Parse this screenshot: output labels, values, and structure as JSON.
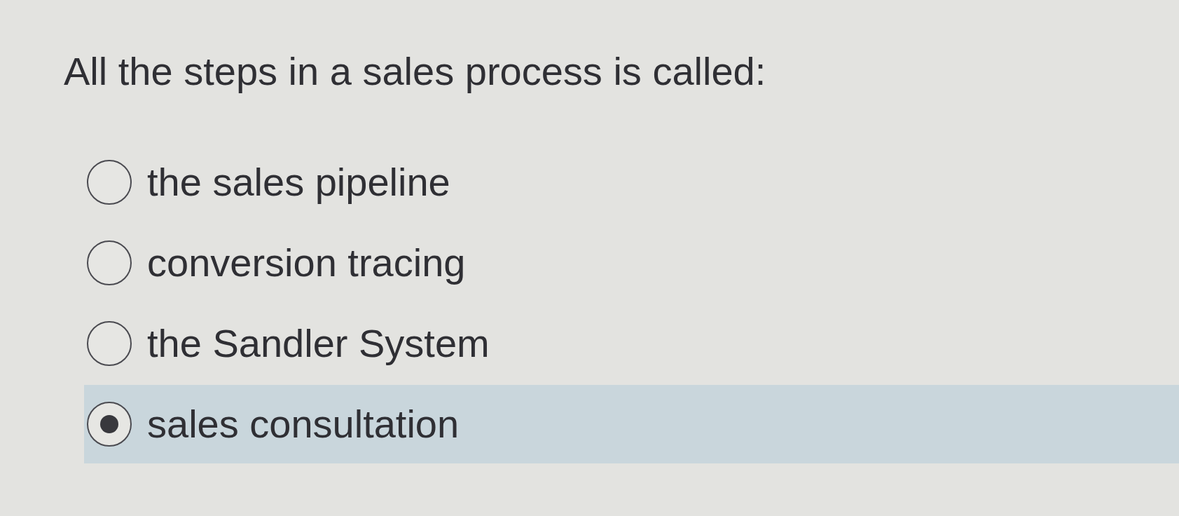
{
  "question": "All the steps in a sales process is called:",
  "options": [
    {
      "label": "the sales pipeline",
      "selected": false
    },
    {
      "label": "conversion tracing",
      "selected": false
    },
    {
      "label": "the Sandler System",
      "selected": false
    },
    {
      "label": "sales consultation",
      "selected": true
    }
  ]
}
